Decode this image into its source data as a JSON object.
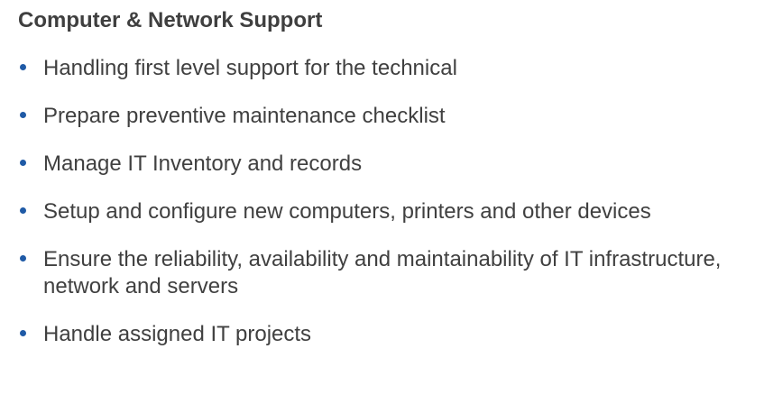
{
  "section": {
    "title": "Computer & Network Support",
    "accent_color": "#1f5aa6",
    "items": [
      {
        "text": "Handling first level support for the technical"
      },
      {
        "text": "Prepare preventive maintenance checklist"
      },
      {
        "text": "Manage IT Inventory and records"
      },
      {
        "text": "Setup and configure new computers, printers and other devices"
      },
      {
        "text": "Ensure the reliability, availability and maintainability of IT infrastructure, network and servers"
      },
      {
        "text": "Handle assigned IT projects"
      }
    ]
  }
}
